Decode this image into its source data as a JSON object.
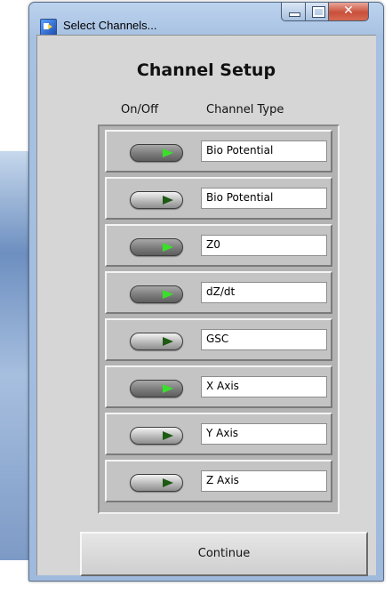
{
  "window": {
    "title": "Select Channels...",
    "close_glyph": "✕"
  },
  "main": {
    "heading": "Channel Setup",
    "col_onoff": "On/Off",
    "col_type": "Channel Type",
    "channels": [
      {
        "type": "Bio Potential",
        "on": true
      },
      {
        "type": "Bio Potential",
        "on": false
      },
      {
        "type": "Z0",
        "on": true
      },
      {
        "type": "dZ/dt",
        "on": true
      },
      {
        "type": "GSC",
        "on": false
      },
      {
        "type": "X Axis",
        "on": true
      },
      {
        "type": "Y Axis",
        "on": false
      },
      {
        "type": "Z Axis",
        "on": false
      }
    ],
    "continue_label": "Continue"
  },
  "colors": {
    "led_on": "#39e02a",
    "led_off": "#1d5a12"
  },
  "icons": {
    "app": "labview-app-icon",
    "minimize": "minimize-icon",
    "maximize": "maximize-icon",
    "close": "close-icon"
  }
}
